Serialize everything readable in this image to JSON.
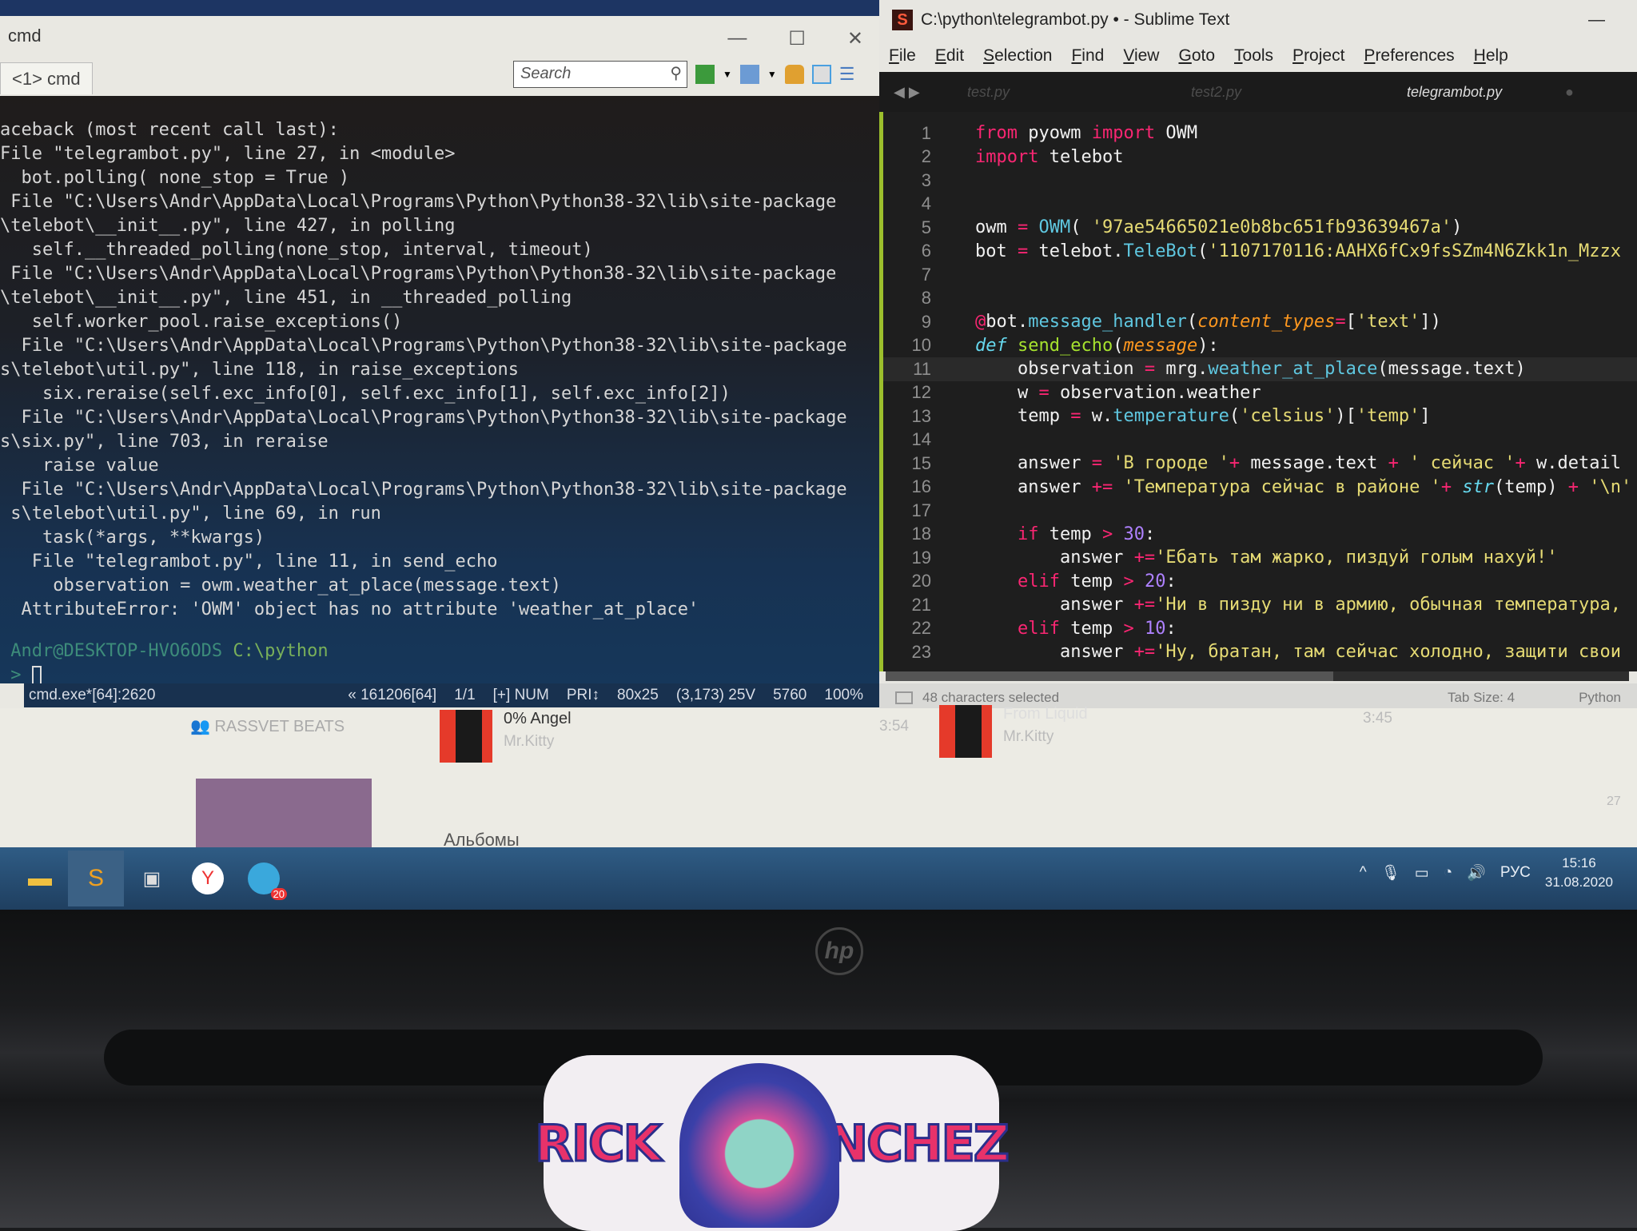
{
  "cmd": {
    "title": "cmd",
    "tab": "<1> cmd",
    "search_placeholder": "Search",
    "window_controls": [
      "—",
      "☐",
      "✕"
    ],
    "lines": [
      "aceback (most recent call last):",
      "File \"telegrambot.py\", line 27, in <module>",
      "  bot.polling( none_stop = True )",
      " File \"C:\\Users\\Andr\\AppData\\Local\\Programs\\Python\\Python38-32\\lib\\site-package",
      "\\telebot\\__init__.py\", line 427, in polling",
      "   self.__threaded_polling(none_stop, interval, timeout)",
      " File \"C:\\Users\\Andr\\AppData\\Local\\Programs\\Python\\Python38-32\\lib\\site-package",
      "\\telebot\\__init__.py\", line 451, in __threaded_polling",
      "   self.worker_pool.raise_exceptions()",
      "  File \"C:\\Users\\Andr\\AppData\\Local\\Programs\\Python\\Python38-32\\lib\\site-package",
      "s\\telebot\\util.py\", line 118, in raise_exceptions",
      "    six.reraise(self.exc_info[0], self.exc_info[1], self.exc_info[2])",
      "  File \"C:\\Users\\Andr\\AppData\\Local\\Programs\\Python\\Python38-32\\lib\\site-package",
      "s\\six.py\", line 703, in reraise",
      "    raise value",
      "  File \"C:\\Users\\Andr\\AppData\\Local\\Programs\\Python\\Python38-32\\lib\\site-package",
      " s\\telebot\\util.py\", line 69, in run",
      "    task(*args, **kwargs)",
      "   File \"telegrambot.py\", line 11, in send_echo",
      "     observation = owm.weather_at_place(message.text)",
      "  AttributeError: 'OWM' object has no attribute 'weather_at_place'"
    ],
    "prompt_user": "Andr@DESKTOP-HVO6ODS",
    "prompt_path": "C:\\python",
    "prompt_symbol": ">",
    "status_left": "cmd.exe*[64]:2620",
    "status_right": [
      "« 161206[64]",
      "1/1",
      "[+] NUM",
      "PRI↕",
      "80x25",
      "(3,173) 25V",
      "5760",
      "100%"
    ]
  },
  "sublime": {
    "title": "C:\\python\\telegrambot.py • - Sublime Text",
    "logo": "S",
    "menu": [
      "File",
      "Edit",
      "Selection",
      "Find",
      "View",
      "Goto",
      "Tools",
      "Project",
      "Preferences",
      "Help"
    ],
    "tabs": [
      "test.py",
      "test2.py",
      "telegrambot.py"
    ],
    "active_tab": 2,
    "current_line": 11,
    "code": [
      [
        [
          "from",
          "kw"
        ],
        [
          " pyowm ",
          ""
        ],
        [
          "import",
          "kw"
        ],
        [
          " OWM",
          ""
        ]
      ],
      [
        [
          "import",
          "kw"
        ],
        [
          " telebot",
          ""
        ]
      ],
      [],
      [],
      [
        [
          "owm ",
          ""
        ],
        [
          "=",
          "kw"
        ],
        [
          " ",
          ""
        ],
        [
          "OWM",
          "fn"
        ],
        [
          "( ",
          ""
        ],
        [
          "'97ae54665021e0b8bc651fb93639467a'",
          "str"
        ],
        [
          ")",
          ""
        ]
      ],
      [
        [
          "bot ",
          ""
        ],
        [
          "=",
          "kw"
        ],
        [
          " telebot.",
          ""
        ],
        [
          "TeleBot",
          "fn"
        ],
        [
          "(",
          ""
        ],
        [
          "'1107170116:AAHX6fCx9fsSZm4N6Zkk1n_Mzzx",
          "str"
        ]
      ],
      [],
      [],
      [
        [
          "@",
          "kw"
        ],
        [
          "bot.",
          ""
        ],
        [
          "message_handler",
          "fn"
        ],
        [
          "(",
          ""
        ],
        [
          "content_types",
          "arg"
        ],
        [
          "=",
          "kw"
        ],
        [
          "[",
          ""
        ],
        [
          "'text'",
          "str"
        ],
        [
          "])",
          ""
        ]
      ],
      [
        [
          "def",
          "fnkw"
        ],
        [
          " ",
          ""
        ],
        [
          "send_echo",
          "def"
        ],
        [
          "(",
          ""
        ],
        [
          "message",
          "arg"
        ],
        [
          "):",
          ""
        ]
      ],
      [
        [
          "    observation ",
          ""
        ],
        [
          "=",
          "kw"
        ],
        [
          " mrg.",
          ""
        ],
        [
          "weather_at_place",
          "fn"
        ],
        [
          "(message.text)",
          ""
        ]
      ],
      [
        [
          "    w ",
          ""
        ],
        [
          "=",
          "kw"
        ],
        [
          " observation.weather",
          ""
        ]
      ],
      [
        [
          "    temp ",
          ""
        ],
        [
          "=",
          "kw"
        ],
        [
          " w.",
          ""
        ],
        [
          "temperature",
          "fn"
        ],
        [
          "(",
          ""
        ],
        [
          "'celsius'",
          "str"
        ],
        [
          ")[",
          ""
        ],
        [
          "'temp'",
          "str"
        ],
        [
          "]",
          ""
        ]
      ],
      [],
      [
        [
          "    answer ",
          ""
        ],
        [
          "=",
          "kw"
        ],
        [
          " ",
          ""
        ],
        [
          "'В городе '",
          "str"
        ],
        [
          "+",
          "kw"
        ],
        [
          " message.text ",
          ""
        ],
        [
          "+",
          "kw"
        ],
        [
          " ",
          ""
        ],
        [
          "' сейчас '",
          "str"
        ],
        [
          "+",
          "kw"
        ],
        [
          " w.detail",
          ""
        ]
      ],
      [
        [
          "    answer ",
          ""
        ],
        [
          "+=",
          "kw"
        ],
        [
          " ",
          ""
        ],
        [
          "'Температура сейчас в районе '",
          "str"
        ],
        [
          "+",
          "kw"
        ],
        [
          " ",
          ""
        ],
        [
          "str",
          "fnit"
        ],
        [
          "(temp) ",
          ""
        ],
        [
          "+",
          "kw"
        ],
        [
          " ",
          ""
        ],
        [
          "'\\n'",
          "str"
        ]
      ],
      [],
      [
        [
          "    ",
          ""
        ],
        [
          "if",
          "kw"
        ],
        [
          " temp ",
          ""
        ],
        [
          ">",
          "kw"
        ],
        [
          " ",
          ""
        ],
        [
          "30",
          "nm"
        ],
        [
          ":",
          ""
        ]
      ],
      [
        [
          "        answer ",
          ""
        ],
        [
          "+=",
          "kw"
        ],
        [
          "'Ебать там жарко, пиздуй голым нахуй!'",
          "str"
        ]
      ],
      [
        [
          "    ",
          ""
        ],
        [
          "elif",
          "kw"
        ],
        [
          " temp ",
          ""
        ],
        [
          ">",
          "kw"
        ],
        [
          " ",
          ""
        ],
        [
          "20",
          "nm"
        ],
        [
          ":",
          ""
        ]
      ],
      [
        [
          "        answer ",
          ""
        ],
        [
          "+=",
          "kw"
        ],
        [
          "'Ни в пизду ни в армию, обычная температура,",
          "str"
        ]
      ],
      [
        [
          "    ",
          ""
        ],
        [
          "elif",
          "kw"
        ],
        [
          " temp ",
          ""
        ],
        [
          ">",
          "kw"
        ],
        [
          " ",
          ""
        ],
        [
          "10",
          "nm"
        ],
        [
          ":",
          ""
        ]
      ],
      [
        [
          "        answer ",
          ""
        ],
        [
          "+=",
          "kw"
        ],
        [
          "'Ну, братан, там сейчас холодно, защити свои",
          "str"
        ]
      ]
    ],
    "status_left": "48 characters selected",
    "tab_size": "Tab Size: 4",
    "syntax": "Python"
  },
  "music_app": {
    "playlist": "RASSVET BEATS",
    "tracks": [
      {
        "title": "0% Angel",
        "artist": "Mr.Kitty",
        "duration": "3:54"
      },
      {
        "title": "From Liquid",
        "artist": "Mr.Kitty",
        "duration": "3:45"
      }
    ],
    "section": "Альбомы",
    "count": "27"
  },
  "taskbar": {
    "apps": [
      "file-explorer",
      "sublime-text",
      "cmd",
      "yandex-browser",
      "telegram"
    ],
    "telegram_badge": "20",
    "language": "РУС",
    "time": "15:16",
    "date": "31.08.2020"
  },
  "device": {
    "brand_logo": "hp",
    "sticker": [
      "RICK",
      "SANCHEZ"
    ]
  }
}
